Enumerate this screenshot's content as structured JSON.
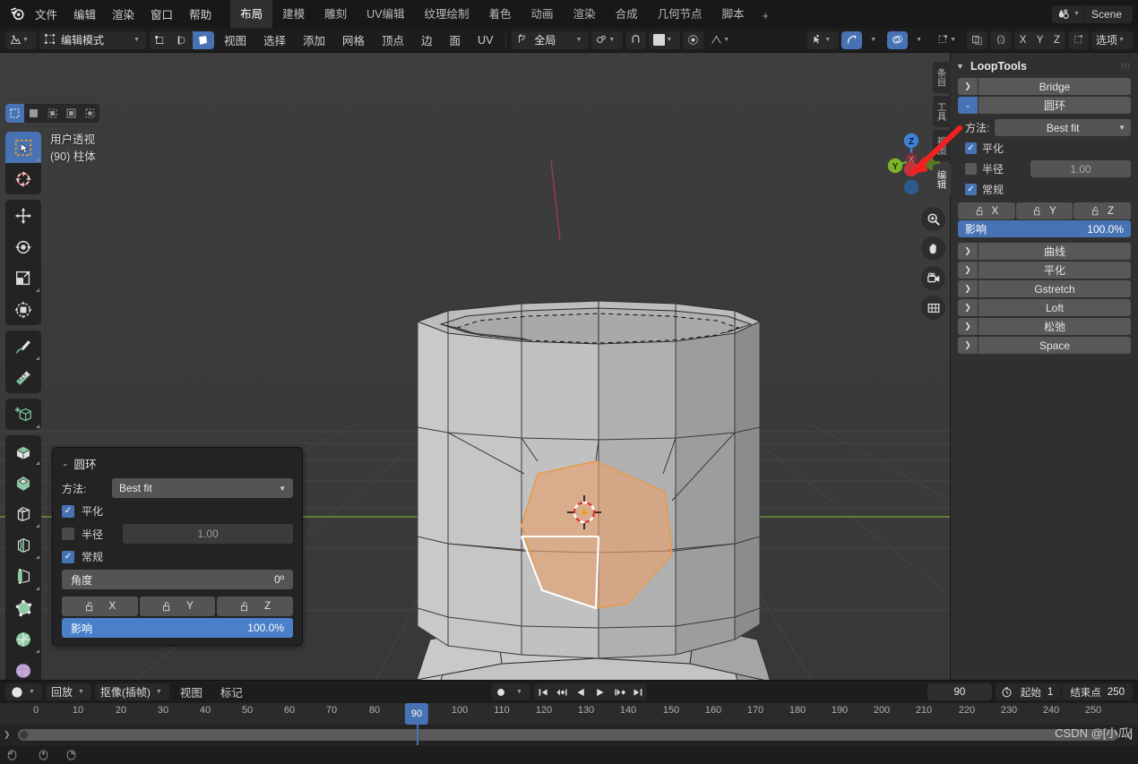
{
  "app": {
    "logo_icon": "blender-logo",
    "menus": [
      "文件",
      "编辑",
      "渲染",
      "窗口",
      "帮助"
    ],
    "workspace_tabs": [
      "布局",
      "建模",
      "雕刻",
      "UV编辑",
      "纹理绘制",
      "着色",
      "动画",
      "渲染",
      "合成",
      "几何节点",
      "脚本"
    ],
    "workspace_active": "布局",
    "add_tab_label": "+",
    "scene_icon": "scene-icon",
    "scene_name": "Scene"
  },
  "viewport_header": {
    "editor_type_icon": "editor-type-icon",
    "mode_icon": "edit-mode-icon",
    "mode_label": "编辑模式",
    "select_mode_icons": [
      "vertex-select-icon",
      "edge-select-icon",
      "face-select-icon"
    ],
    "select_mode_active_index": 2,
    "menus": [
      "视图",
      "选择",
      "添加",
      "网格",
      "顶点",
      "边",
      "面",
      "UV"
    ],
    "orientation_icon": "transform-orientation-icon",
    "orientation_label": "全局",
    "pivot_icon": "pivot-point-icon",
    "snap_icon": "magnet-icon",
    "snap_target_icon": "snap-target-icon",
    "proportional_icon": "proportional-edit-icon",
    "falloff_icon": "falloff-curve-icon",
    "right_icons": [
      "visibility-icon",
      "gizmo-icon",
      "overlays-icon",
      "xray-icon"
    ],
    "xray_axes": [
      "X",
      "Y",
      "Z"
    ],
    "mirror_icon": "mirror-icon",
    "options_label": "选项",
    "shading_icons": [
      "wireframe-shading-icon",
      "solid-shading-icon",
      "material-preview-icon",
      "rendered-shading-icon"
    ],
    "shading_active_index": 1
  },
  "viewport": {
    "overlay_line1": "用户透视",
    "overlay_line2": "(90) 柱体",
    "gizmo_axes": [
      "Z",
      "Y",
      "X"
    ],
    "nav_buttons": [
      "zoom-icon",
      "pan-hand-icon",
      "camera-view-icon",
      "toggle-orthographic-icon"
    ]
  },
  "left_toolbar": {
    "groups": [
      [
        {
          "icon": "tweak-select-box-icon",
          "active": true
        },
        {
          "icon": "cursor-3d-icon",
          "active": false
        }
      ],
      [
        {
          "icon": "move-icon",
          "active": false
        },
        {
          "icon": "rotate-icon",
          "active": false
        },
        {
          "icon": "scale-icon",
          "active": false
        },
        {
          "icon": "transform-icon",
          "active": false
        }
      ],
      [
        {
          "icon": "annotate-icon",
          "active": false
        },
        {
          "icon": "measure-icon",
          "active": false
        }
      ],
      [
        {
          "icon": "add-cube-icon",
          "active": false
        }
      ],
      [
        {
          "icon": "extrude-region-icon",
          "active": false
        },
        {
          "icon": "inset-faces-icon",
          "active": false
        },
        {
          "icon": "bevel-icon",
          "active": false
        },
        {
          "icon": "loop-cut-icon",
          "active": false
        },
        {
          "icon": "knife-icon",
          "active": false
        },
        {
          "icon": "poly-build-icon",
          "active": false
        },
        {
          "icon": "spin-icon",
          "active": false
        },
        {
          "icon": "smooth-icon",
          "active": false
        },
        {
          "icon": "shear-icon",
          "active": false
        }
      ],
      [
        {
          "icon": "rip-region-icon",
          "active": false
        }
      ]
    ]
  },
  "npanel": {
    "title": "LoopTools",
    "grip_icon": "drag-grip-icon",
    "tabs": [
      "条目",
      "工具",
      "视图",
      "编辑"
    ],
    "active_tab_index": 3,
    "sections_top": [
      {
        "label": "Bridge",
        "open": false
      },
      {
        "label": "圆环",
        "open": true
      }
    ],
    "circle": {
      "method_label": "方法:",
      "method_value": "Best fit",
      "flatten_label": "平化",
      "flatten_checked": true,
      "radius_label": "半径",
      "radius_checked": false,
      "radius_value": "1.00",
      "regular_label": "常规",
      "regular_checked": true,
      "axes": [
        "X",
        "Y",
        "Z"
      ],
      "lock_icon": "unlocked-padlock-icon",
      "influence_label": "影响",
      "influence_value": "100.0%"
    },
    "sections_bottom": [
      {
        "label": "曲线",
        "open": false
      },
      {
        "label": "平化",
        "open": false
      },
      {
        "label": "Gstretch",
        "open": false
      },
      {
        "label": "Loft",
        "open": false
      },
      {
        "label": "松弛",
        "open": false
      },
      {
        "label": "Space",
        "open": false
      }
    ]
  },
  "redo_panel": {
    "title": "圆环",
    "method_label": "方法:",
    "method_value": "Best fit",
    "flatten_label": "平化",
    "flatten_checked": true,
    "radius_label": "半径",
    "radius_checked": false,
    "radius_value": "1.00",
    "regular_label": "常规",
    "regular_checked": true,
    "angle_label": "角度",
    "angle_value": "0º",
    "axes": [
      "X",
      "Y",
      "Z"
    ],
    "lock_icon": "unlocked-padlock-icon",
    "influence_label": "影响",
    "influence_value": "100.0%"
  },
  "timeline": {
    "editor_icon": "timeline-editor-icon",
    "playback_label": "回放",
    "keying_label": "抠像(插帧)",
    "menus": [
      "视图",
      "标记"
    ],
    "record_icon": "auto-keying-icon",
    "transport_icons": [
      "jump-to-start-icon",
      "previous-keyframe-icon",
      "play-reverse-icon",
      "play-icon",
      "next-keyframe-icon",
      "jump-to-end-icon"
    ],
    "current_frame": "90",
    "clock_icon": "clock-icon",
    "start_label": "起始",
    "start_value": "1",
    "end_label": "结束点",
    "end_value": "250",
    "ruler_ticks": [
      "0",
      "10",
      "20",
      "30",
      "40",
      "50",
      "60",
      "70",
      "80",
      "90",
      "100",
      "110",
      "120",
      "130",
      "140",
      "150",
      "160",
      "170",
      "180",
      "190",
      "200",
      "210",
      "220",
      "230",
      "240",
      "250"
    ],
    "playhead_label": "90"
  },
  "watermark": "CSDN @[小瓜]",
  "colors": {
    "accent_blue": "#4772b3",
    "panel_bg": "#303030",
    "header_bg": "#1d1d1d",
    "viewport_bg": "#393939",
    "selected_face": "#e8a06a",
    "active_edge": "#ffffff",
    "arrow_red": "#f42020"
  }
}
